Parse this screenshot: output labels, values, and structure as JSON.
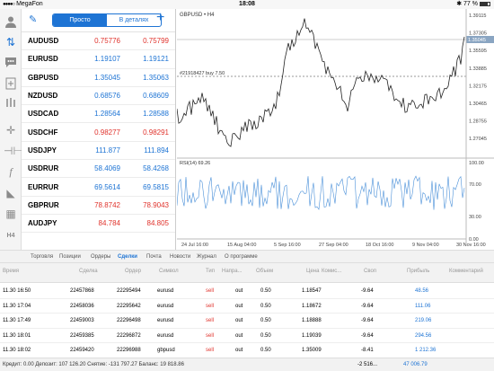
{
  "status": {
    "carrier": "MegaFon",
    "time": "18:08",
    "battery": "77 %"
  },
  "quotes": {
    "tab_simple": "Просто",
    "tab_detailed": "В деталях",
    "rows": [
      {
        "symbol": "AUDUSD",
        "bid": "0.75776",
        "ask": "0.75799",
        "color": "red"
      },
      {
        "symbol": "EURUSD",
        "bid": "1.19107",
        "ask": "1.19121",
        "color": "blue"
      },
      {
        "symbol": "GBPUSD",
        "bid": "1.35045",
        "ask": "1.35063",
        "color": "blue"
      },
      {
        "symbol": "NZDUSD",
        "bid": "0.68576",
        "ask": "0.68609",
        "color": "blue"
      },
      {
        "symbol": "USDCAD",
        "bid": "1.28564",
        "ask": "1.28588",
        "color": "blue"
      },
      {
        "symbol": "USDCHF",
        "bid": "0.98277",
        "ask": "0.98291",
        "color": "red"
      },
      {
        "symbol": "USDJPY",
        "bid": "111.877",
        "ask": "111.894",
        "color": "blue"
      },
      {
        "symbol": "USDRUR",
        "bid": "58.4069",
        "ask": "58.4268",
        "color": "blue"
      },
      {
        "symbol": "EURRUR",
        "bid": "69.5614",
        "ask": "69.5815",
        "color": "blue"
      },
      {
        "symbol": "GBPRUR",
        "bid": "78.8742",
        "ask": "78.9043",
        "color": "red"
      },
      {
        "symbol": "AUDJPY",
        "bid": "84.784",
        "ask": "84.805",
        "color": "red"
      }
    ]
  },
  "chart": {
    "title": "GBPUSD • H4",
    "order_label": "#21918427 buy 7.50",
    "current_price": "1.35045",
    "price_ticks": [
      "1.39115",
      "1.37305",
      "1.35595",
      "1.33885",
      "1.32175",
      "1.30465",
      "1.28755",
      "1.27045"
    ],
    "rsi_label": "RSI(14) 69.26",
    "rsi_ticks": [
      "100.00",
      "70.00",
      "30.00",
      "0.00"
    ],
    "date_ticks": [
      "24 Jul 16:00",
      "15 Aug 04:00",
      "5 Sep 16:00",
      "27 Sep 04:00",
      "18 Oct 16:00",
      "9 Nov 04:00",
      "30 Nov 16:00"
    ]
  },
  "tabs": [
    "Торговля",
    "Позиции",
    "Ордеры",
    "Сделки",
    "Почта",
    "Новости",
    "Журнал",
    "О программе"
  ],
  "active_tab": "Сделки",
  "table": {
    "headers": [
      "Время",
      "Сделка",
      "Ордер",
      "Символ",
      "Тип",
      "Напра...",
      "Объем",
      "Цена",
      "Комис...",
      "Своп",
      "Прибыль",
      "Комментарий"
    ],
    "rows": [
      [
        "11.30 16:50",
        "22457868",
        "22295494",
        "eurusd",
        "sell",
        "out",
        "0.50",
        "1.18547",
        "",
        "-9.64",
        "48.56",
        ""
      ],
      [
        "11.30 17:04",
        "22458036",
        "22295642",
        "eurusd",
        "sell",
        "out",
        "0.50",
        "1.18672",
        "",
        "-9.64",
        "111.06",
        ""
      ],
      [
        "11.30 17:49",
        "22459003",
        "22296498",
        "eurusd",
        "sell",
        "out",
        "0.50",
        "1.18888",
        "",
        "-9.64",
        "219.06",
        ""
      ],
      [
        "11.30 18:01",
        "22459385",
        "22296872",
        "eurusd",
        "sell",
        "out",
        "0.50",
        "1.19039",
        "",
        "-9.64",
        "294.56",
        ""
      ],
      [
        "11.30 18:02",
        "22459420",
        "22296988",
        "gbpusd",
        "sell",
        "out",
        "0.50",
        "1.35009",
        "",
        "-8.41",
        "1 212.36",
        ""
      ]
    ]
  },
  "footer": {
    "summary": "Кредит: 0.00 Депозит: 107 126.20 Снятие: -131 797.27 Баланс: 19 818.86",
    "swap_total": "-2 516...",
    "profit_total": "47 006.79"
  },
  "colors": {
    "accent": "#1e74d4",
    "sell": "#e0332c"
  }
}
